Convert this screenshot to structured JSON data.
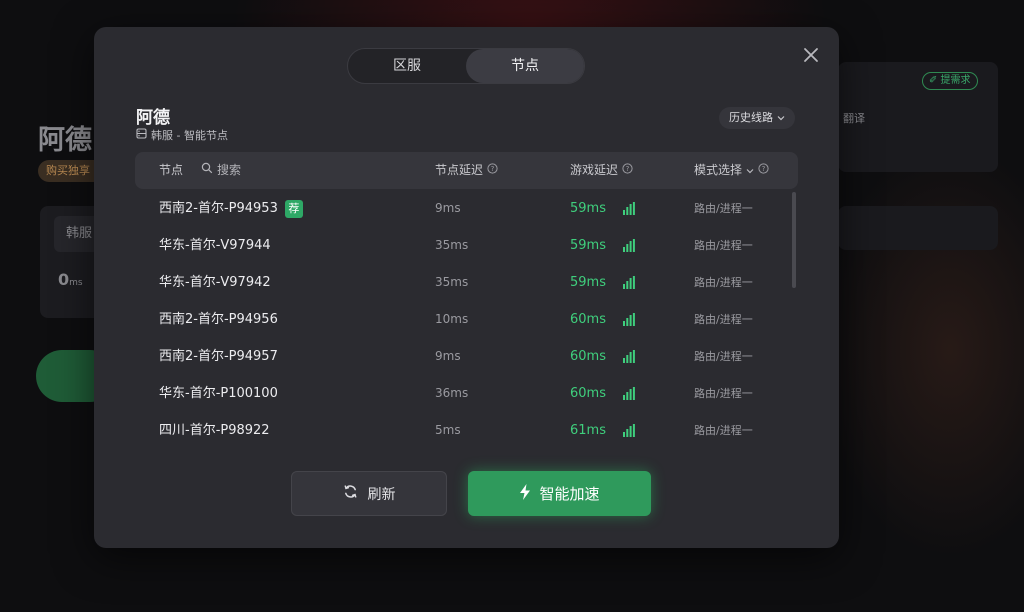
{
  "background": {
    "title": "阿德",
    "buy_label": "购买独享",
    "region_label": "韩服",
    "latency_value": "0",
    "latency_unit": "ms",
    "tag_label": "✐ 提需求",
    "translate_label": "翻译"
  },
  "modal": {
    "tabs": [
      {
        "label": "区服",
        "active": false
      },
      {
        "label": "节点",
        "active": true
      }
    ],
    "game_title": "阿德",
    "sub_info": "韩服 - 智能节点",
    "history_label": "历史线路",
    "table": {
      "col_node": "节点",
      "search_placeholder": "搜索",
      "col_node_latency": "节点延迟",
      "col_game_latency": "游戏延迟",
      "col_mode": "模式选择",
      "rows": [
        {
          "name": "西南2-首尔-P94953",
          "badge": "荐",
          "node_latency": "9ms",
          "game_latency": "59ms",
          "mode": "路由/进程一"
        },
        {
          "name": "华东-首尔-V97944",
          "badge": "",
          "node_latency": "35ms",
          "game_latency": "59ms",
          "mode": "路由/进程一"
        },
        {
          "name": "华东-首尔-V97942",
          "badge": "",
          "node_latency": "35ms",
          "game_latency": "59ms",
          "mode": "路由/进程一"
        },
        {
          "name": "西南2-首尔-P94956",
          "badge": "",
          "node_latency": "10ms",
          "game_latency": "60ms",
          "mode": "路由/进程一"
        },
        {
          "name": "西南2-首尔-P94957",
          "badge": "",
          "node_latency": "9ms",
          "game_latency": "60ms",
          "mode": "路由/进程一"
        },
        {
          "name": "华东-首尔-P100100",
          "badge": "",
          "node_latency": "36ms",
          "game_latency": "60ms",
          "mode": "路由/进程一"
        },
        {
          "name": "四川-首尔-P98922",
          "badge": "",
          "node_latency": "5ms",
          "game_latency": "61ms",
          "mode": "路由/进程一"
        }
      ]
    },
    "refresh_label": "刷新",
    "accelerate_label": "智能加速"
  },
  "colors": {
    "accent_green": "#2f9a5c",
    "latency_green": "#3fcf7d",
    "modal_bg": "#2b2b30"
  }
}
